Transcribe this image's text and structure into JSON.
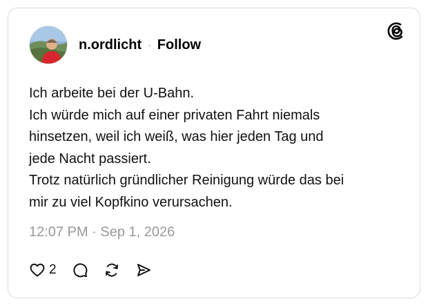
{
  "post": {
    "username": "n.ordlicht",
    "separator": "·",
    "follow_label": "Follow",
    "lines": [
      "Ich arbeite bei der U-Bahn.",
      "Ich würde mich auf einer privaten Fahrt niemals",
      "hinsetzen, weil ich weiß, was hier jeden Tag und",
      "jede Nacht passiert.",
      "Trotz natürlich gründlicher Reinigung würde das bei",
      "mir zu viel Kopfkino verursachen."
    ],
    "timestamp": "12:07 PM · Sep 1, 2026",
    "like_count": "2"
  },
  "icons": {
    "brand": "threads-logo",
    "like": "heart-icon",
    "reply": "comment-icon",
    "repost": "repost-icon",
    "share": "share-icon"
  },
  "colors": {
    "text": "#111111",
    "muted": "#999999",
    "border": "#d9d9d9"
  }
}
